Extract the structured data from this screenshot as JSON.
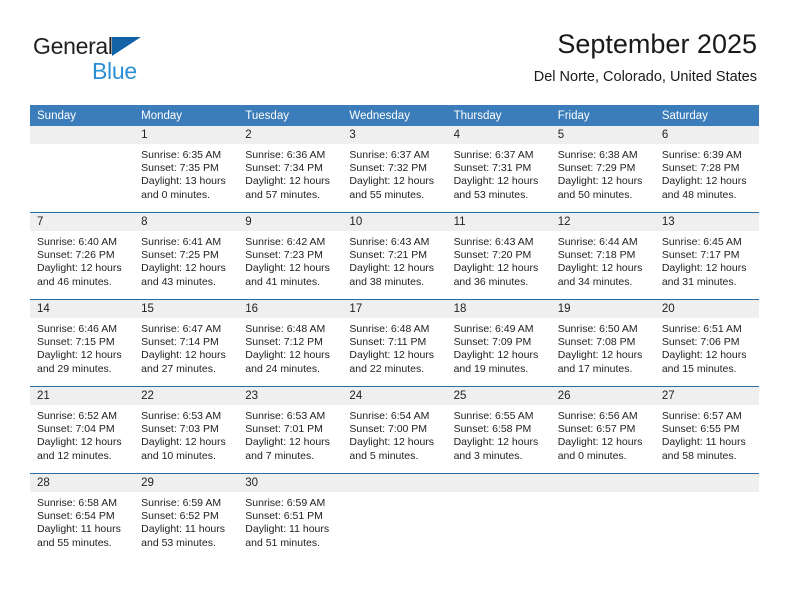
{
  "brand": {
    "name_part1": "General",
    "name_part2": "Blue",
    "triangle_color": "#1262a8",
    "blue_color": "#2b8fd4"
  },
  "header": {
    "title": "September 2025",
    "subtitle": "Del Norte, Colorado, United States"
  },
  "colors": {
    "header_row_bg": "#3b7cba",
    "date_band_bg": "#efefef",
    "week_divider": "#2d6da4",
    "text": "#222222"
  },
  "weekday_headers": [
    "Sunday",
    "Monday",
    "Tuesday",
    "Wednesday",
    "Thursday",
    "Friday",
    "Saturday"
  ],
  "labels": {
    "sunrise_prefix": "Sunrise:",
    "sunset_prefix": "Sunset:",
    "daylight_prefix": "Daylight:"
  },
  "weeks": [
    [
      {
        "date": "",
        "empty": true
      },
      {
        "date": "1",
        "sunrise": "Sunrise: 6:35 AM",
        "sunset": "Sunset: 7:35 PM",
        "daylight1": "Daylight: 13 hours",
        "daylight2": "and 0 minutes."
      },
      {
        "date": "2",
        "sunrise": "Sunrise: 6:36 AM",
        "sunset": "Sunset: 7:34 PM",
        "daylight1": "Daylight: 12 hours",
        "daylight2": "and 57 minutes."
      },
      {
        "date": "3",
        "sunrise": "Sunrise: 6:37 AM",
        "sunset": "Sunset: 7:32 PM",
        "daylight1": "Daylight: 12 hours",
        "daylight2": "and 55 minutes."
      },
      {
        "date": "4",
        "sunrise": "Sunrise: 6:37 AM",
        "sunset": "Sunset: 7:31 PM",
        "daylight1": "Daylight: 12 hours",
        "daylight2": "and 53 minutes."
      },
      {
        "date": "5",
        "sunrise": "Sunrise: 6:38 AM",
        "sunset": "Sunset: 7:29 PM",
        "daylight1": "Daylight: 12 hours",
        "daylight2": "and 50 minutes."
      },
      {
        "date": "6",
        "sunrise": "Sunrise: 6:39 AM",
        "sunset": "Sunset: 7:28 PM",
        "daylight1": "Daylight: 12 hours",
        "daylight2": "and 48 minutes."
      }
    ],
    [
      {
        "date": "7",
        "sunrise": "Sunrise: 6:40 AM",
        "sunset": "Sunset: 7:26 PM",
        "daylight1": "Daylight: 12 hours",
        "daylight2": "and 46 minutes."
      },
      {
        "date": "8",
        "sunrise": "Sunrise: 6:41 AM",
        "sunset": "Sunset: 7:25 PM",
        "daylight1": "Daylight: 12 hours",
        "daylight2": "and 43 minutes."
      },
      {
        "date": "9",
        "sunrise": "Sunrise: 6:42 AM",
        "sunset": "Sunset: 7:23 PM",
        "daylight1": "Daylight: 12 hours",
        "daylight2": "and 41 minutes."
      },
      {
        "date": "10",
        "sunrise": "Sunrise: 6:43 AM",
        "sunset": "Sunset: 7:21 PM",
        "daylight1": "Daylight: 12 hours",
        "daylight2": "and 38 minutes."
      },
      {
        "date": "11",
        "sunrise": "Sunrise: 6:43 AM",
        "sunset": "Sunset: 7:20 PM",
        "daylight1": "Daylight: 12 hours",
        "daylight2": "and 36 minutes."
      },
      {
        "date": "12",
        "sunrise": "Sunrise: 6:44 AM",
        "sunset": "Sunset: 7:18 PM",
        "daylight1": "Daylight: 12 hours",
        "daylight2": "and 34 minutes."
      },
      {
        "date": "13",
        "sunrise": "Sunrise: 6:45 AM",
        "sunset": "Sunset: 7:17 PM",
        "daylight1": "Daylight: 12 hours",
        "daylight2": "and 31 minutes."
      }
    ],
    [
      {
        "date": "14",
        "sunrise": "Sunrise: 6:46 AM",
        "sunset": "Sunset: 7:15 PM",
        "daylight1": "Daylight: 12 hours",
        "daylight2": "and 29 minutes."
      },
      {
        "date": "15",
        "sunrise": "Sunrise: 6:47 AM",
        "sunset": "Sunset: 7:14 PM",
        "daylight1": "Daylight: 12 hours",
        "daylight2": "and 27 minutes."
      },
      {
        "date": "16",
        "sunrise": "Sunrise: 6:48 AM",
        "sunset": "Sunset: 7:12 PM",
        "daylight1": "Daylight: 12 hours",
        "daylight2": "and 24 minutes."
      },
      {
        "date": "17",
        "sunrise": "Sunrise: 6:48 AM",
        "sunset": "Sunset: 7:11 PM",
        "daylight1": "Daylight: 12 hours",
        "daylight2": "and 22 minutes."
      },
      {
        "date": "18",
        "sunrise": "Sunrise: 6:49 AM",
        "sunset": "Sunset: 7:09 PM",
        "daylight1": "Daylight: 12 hours",
        "daylight2": "and 19 minutes."
      },
      {
        "date": "19",
        "sunrise": "Sunrise: 6:50 AM",
        "sunset": "Sunset: 7:08 PM",
        "daylight1": "Daylight: 12 hours",
        "daylight2": "and 17 minutes."
      },
      {
        "date": "20",
        "sunrise": "Sunrise: 6:51 AM",
        "sunset": "Sunset: 7:06 PM",
        "daylight1": "Daylight: 12 hours",
        "daylight2": "and 15 minutes."
      }
    ],
    [
      {
        "date": "21",
        "sunrise": "Sunrise: 6:52 AM",
        "sunset": "Sunset: 7:04 PM",
        "daylight1": "Daylight: 12 hours",
        "daylight2": "and 12 minutes."
      },
      {
        "date": "22",
        "sunrise": "Sunrise: 6:53 AM",
        "sunset": "Sunset: 7:03 PM",
        "daylight1": "Daylight: 12 hours",
        "daylight2": "and 10 minutes."
      },
      {
        "date": "23",
        "sunrise": "Sunrise: 6:53 AM",
        "sunset": "Sunset: 7:01 PM",
        "daylight1": "Daylight: 12 hours",
        "daylight2": "and 7 minutes."
      },
      {
        "date": "24",
        "sunrise": "Sunrise: 6:54 AM",
        "sunset": "Sunset: 7:00 PM",
        "daylight1": "Daylight: 12 hours",
        "daylight2": "and 5 minutes."
      },
      {
        "date": "25",
        "sunrise": "Sunrise: 6:55 AM",
        "sunset": "Sunset: 6:58 PM",
        "daylight1": "Daylight: 12 hours",
        "daylight2": "and 3 minutes."
      },
      {
        "date": "26",
        "sunrise": "Sunrise: 6:56 AM",
        "sunset": "Sunset: 6:57 PM",
        "daylight1": "Daylight: 12 hours",
        "daylight2": "and 0 minutes."
      },
      {
        "date": "27",
        "sunrise": "Sunrise: 6:57 AM",
        "sunset": "Sunset: 6:55 PM",
        "daylight1": "Daylight: 11 hours",
        "daylight2": "and 58 minutes."
      }
    ],
    [
      {
        "date": "28",
        "sunrise": "Sunrise: 6:58 AM",
        "sunset": "Sunset: 6:54 PM",
        "daylight1": "Daylight: 11 hours",
        "daylight2": "and 55 minutes."
      },
      {
        "date": "29",
        "sunrise": "Sunrise: 6:59 AM",
        "sunset": "Sunset: 6:52 PM",
        "daylight1": "Daylight: 11 hours",
        "daylight2": "and 53 minutes."
      },
      {
        "date": "30",
        "sunrise": "Sunrise: 6:59 AM",
        "sunset": "Sunset: 6:51 PM",
        "daylight1": "Daylight: 11 hours",
        "daylight2": "and 51 minutes."
      },
      {
        "date": "",
        "empty": true
      },
      {
        "date": "",
        "empty": true
      },
      {
        "date": "",
        "empty": true
      },
      {
        "date": "",
        "empty": true
      }
    ]
  ]
}
